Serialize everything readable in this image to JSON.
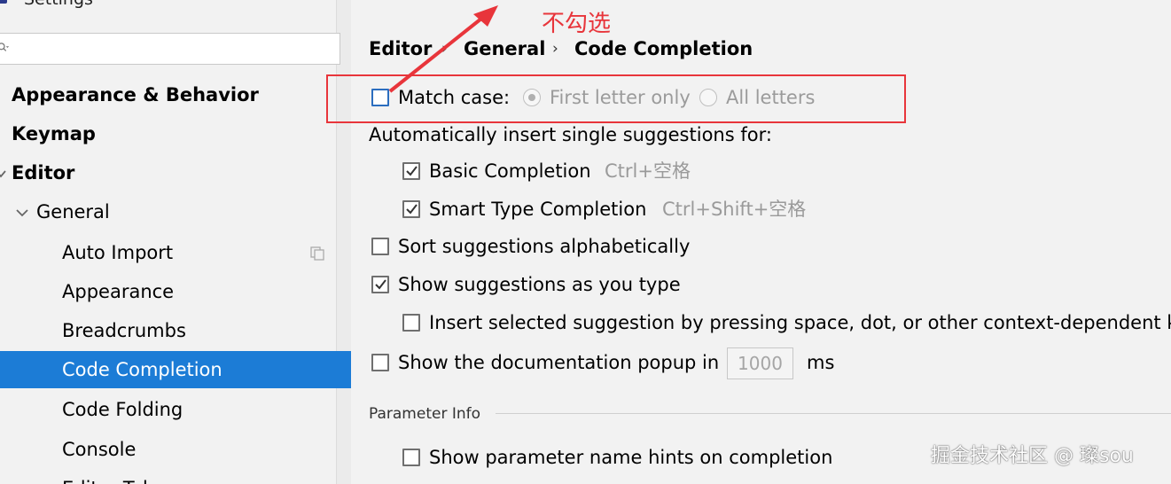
{
  "window": {
    "title": "Settings"
  },
  "search": {
    "placeholder": ""
  },
  "sidebar": {
    "items": [
      {
        "label": "Appearance & Behavior"
      },
      {
        "label": "Keymap"
      },
      {
        "label": "Editor"
      },
      {
        "label": "General"
      },
      {
        "label": "Auto Import"
      },
      {
        "label": "Appearance"
      },
      {
        "label": "Breadcrumbs"
      },
      {
        "label": "Code Completion"
      },
      {
        "label": "Code Folding"
      },
      {
        "label": "Console"
      },
      {
        "label": "Editor Tabs"
      }
    ]
  },
  "breadcrumb": {
    "items": [
      "Editor",
      "General",
      "Code Completion"
    ],
    "separator": "›"
  },
  "options": {
    "match_case": {
      "label": "Match case:",
      "checked": false
    },
    "radio_first": {
      "label": "First letter only",
      "selected": true
    },
    "radio_all": {
      "label": "All letters",
      "selected": false
    },
    "auto_insert_label": "Automatically insert single suggestions for:",
    "basic": {
      "label": "Basic Completion",
      "shortcut": "Ctrl+空格",
      "checked": true
    },
    "smart": {
      "label": "Smart Type Completion",
      "shortcut": "Ctrl+Shift+空格",
      "checked": true
    },
    "sort": {
      "label": "Sort suggestions alphabetically",
      "checked": false
    },
    "show_as_type": {
      "label": "Show suggestions as you type",
      "checked": true
    },
    "insert_selected": {
      "label": "Insert selected suggestion by pressing space, dot, or other context-dependent k",
      "checked": false
    },
    "doc_popup": {
      "label": "Show the documentation popup in",
      "value": "1000",
      "unit": "ms",
      "checked": false
    },
    "param_section": "Parameter Info",
    "param_hints": {
      "label": "Show parameter name hints on completion",
      "checked": false
    }
  },
  "annotation": {
    "text": "不勾选",
    "color": "#e8353b"
  },
  "watermark": {
    "text": "掘金技术社区 @ 璨sou"
  },
  "colors": {
    "selection": "#1c7cd6",
    "background": "#f2f2f2"
  }
}
